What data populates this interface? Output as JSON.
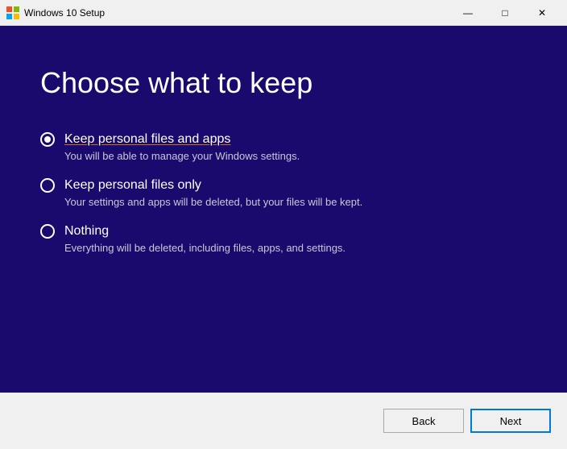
{
  "titleBar": {
    "title": "Windows 10 Setup",
    "minimize": "—",
    "maximize": "□",
    "close": "✕"
  },
  "page": {
    "title": "Choose what to keep",
    "options": [
      {
        "id": "keep-files-apps",
        "label": "Keep personal files and apps",
        "description": "You will be able to manage your Windows settings.",
        "selected": true
      },
      {
        "id": "keep-files-only",
        "label": "Keep personal files only",
        "description": "Your settings and apps will be deleted, but your files will be kept.",
        "selected": false
      },
      {
        "id": "nothing",
        "label": "Nothing",
        "description": "Everything will be deleted, including files, apps, and settings.",
        "selected": false
      }
    ]
  },
  "buttons": {
    "back": "Back",
    "next": "Next"
  }
}
